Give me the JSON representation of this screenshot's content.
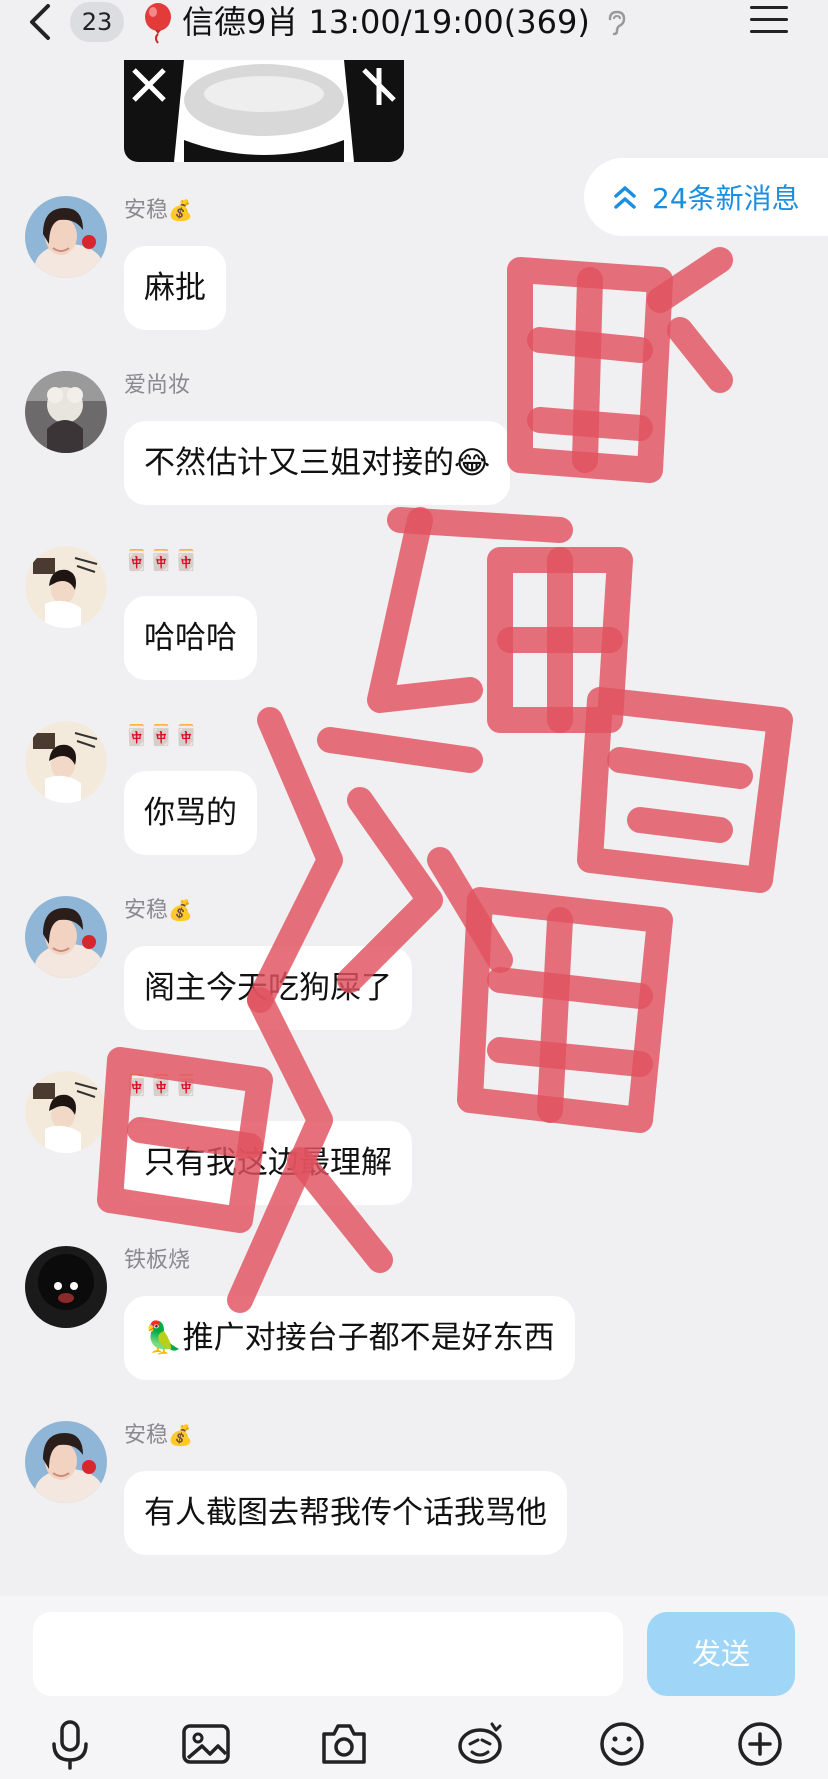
{
  "header": {
    "back_count": "23",
    "title": "信德9肖 13:00/19:00(369)",
    "icons": {
      "back": "chevron-left-icon",
      "balloon": "balloon-icon",
      "ear": "ear-icon",
      "menu": "menu-icon"
    }
  },
  "new_messages": {
    "label": "24条新消息",
    "icon": "double-chevron-up-icon",
    "color": "#1a8ee0"
  },
  "messages": [
    {
      "sender": "安稳",
      "badge": "💰",
      "text": "麻批"
    },
    {
      "sender": "爱尚妆",
      "badge": "",
      "text": "不然估计又三姐对接的😂"
    },
    {
      "sender": "",
      "badge": "🀄🀄🀄",
      "text": "哈哈哈"
    },
    {
      "sender": "",
      "badge": "🀄🀄🀄",
      "text": "你骂的"
    },
    {
      "sender": "安稳",
      "badge": "💰",
      "text": "阁主今天吃狗屎了"
    },
    {
      "sender": "",
      "badge": "🀄🀄🀄",
      "text": "只有我这边最理解"
    },
    {
      "sender": "铁板烧",
      "badge": "",
      "text": "🦜推广对接台子都不是好东西"
    },
    {
      "sender": "安稳",
      "badge": "💰",
      "text": "有人截图去帮我传个话我骂他"
    }
  ],
  "input": {
    "placeholder": "",
    "value": ""
  },
  "send_label": "发送",
  "toolbar": [
    "microphone-icon",
    "image-icon",
    "camera-icon",
    "sticker-icon",
    "emoji-icon",
    "plus-icon"
  ],
  "colors": {
    "background": "#f0f0f2",
    "bubble": "#ffffff",
    "send_button": "#9fd6f7",
    "watermark": "#e0525f"
  }
}
